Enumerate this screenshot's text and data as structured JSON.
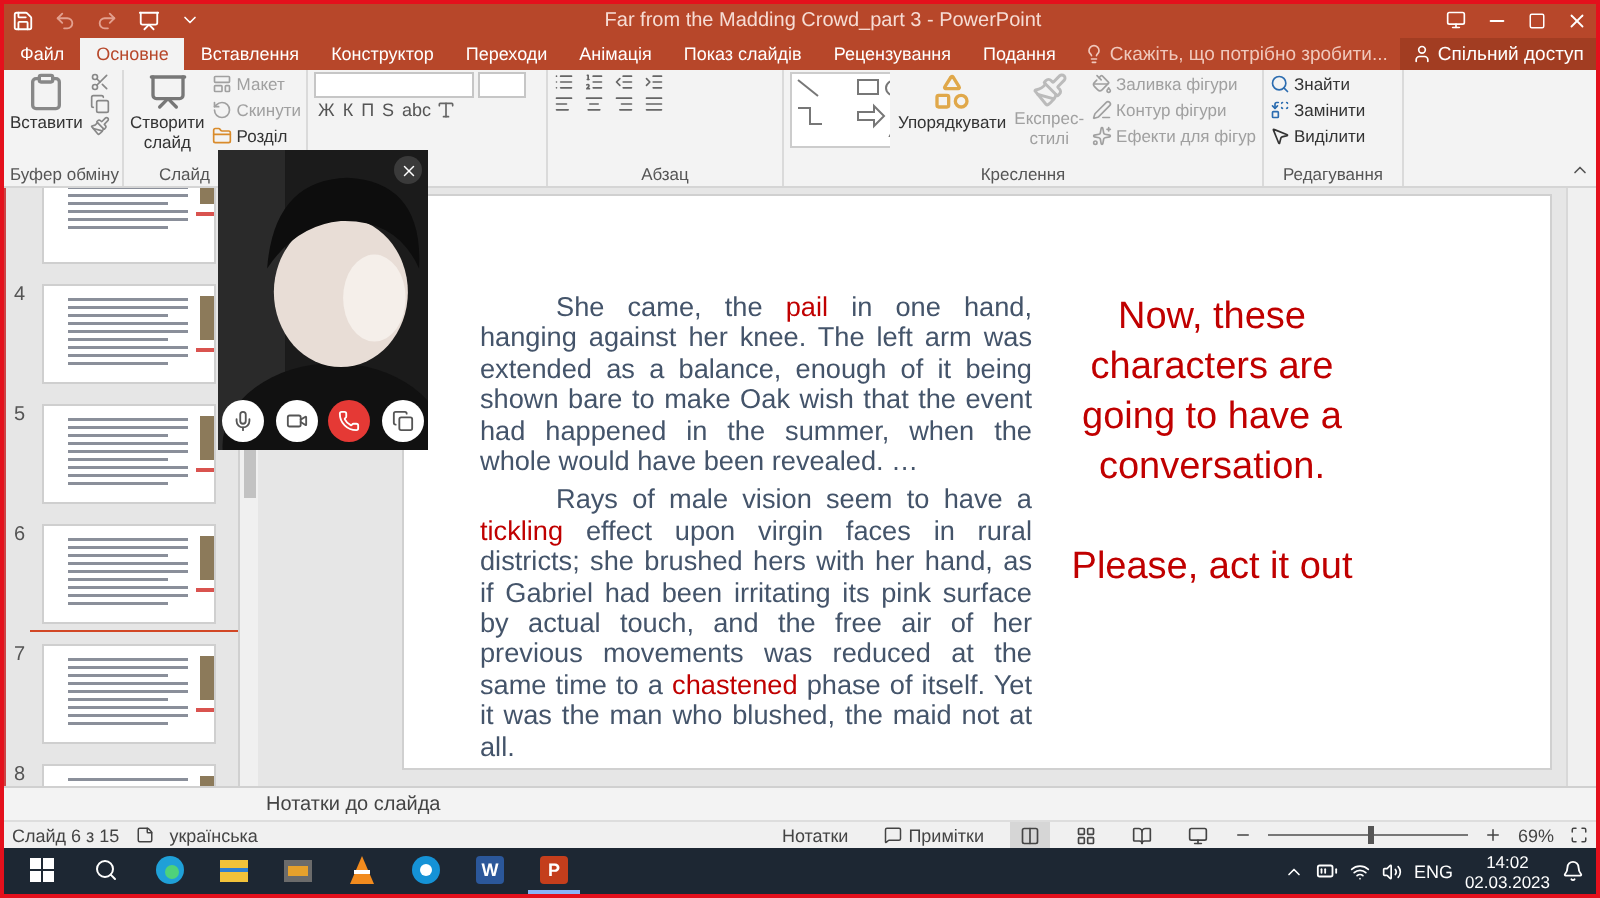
{
  "window": {
    "title": "Far from the Madding Crowd_part 3 - PowerPoint"
  },
  "tabs": [
    {
      "label": "Файл",
      "selected": false
    },
    {
      "label": "Основне",
      "selected": true
    },
    {
      "label": "Вставлення",
      "selected": false
    },
    {
      "label": "Конструктор",
      "selected": false
    },
    {
      "label": "Переходи",
      "selected": false
    },
    {
      "label": "Анімація",
      "selected": false
    },
    {
      "label": "Показ слайдів",
      "selected": false
    },
    {
      "label": "Рецензування",
      "selected": false
    },
    {
      "label": "Подання",
      "selected": false
    }
  ],
  "tell_me": {
    "placeholder": "Скажіть, що потрібно зробити..."
  },
  "share_button": "Спільний доступ",
  "ribbon": {
    "clipboard": {
      "label": "Буфер обміну",
      "paste": "Вставити"
    },
    "slides": {
      "label": "Слайд",
      "new_slide": [
        "Створити",
        "слайд"
      ],
      "items": [
        {
          "label": "Макет",
          "disabled": true
        },
        {
          "label": "Скинути",
          "disabled": true
        },
        {
          "label": "Розділ",
          "disabled": false
        }
      ]
    },
    "font": {
      "format_buttons": [
        "Ж",
        "К",
        "П",
        "S",
        "abc"
      ]
    },
    "paragraph": {
      "label": "Абзац"
    },
    "drawing": {
      "label": "Креслення",
      "arrange": "Упорядкувати",
      "quick_styles": {
        "label": "Експрес-стилі",
        "disabled": true
      },
      "items": [
        {
          "label": "Заливка фігури",
          "disabled": true
        },
        {
          "label": "Контур фігури",
          "disabled": true
        },
        {
          "label": "Ефекти для фігур",
          "disabled": true
        }
      ]
    },
    "editing": {
      "label": "Редагування",
      "items": [
        {
          "label": "Знайти",
          "kind": "find"
        },
        {
          "label": "Замінити",
          "kind": "replace"
        },
        {
          "label": "Виділити",
          "kind": "select"
        }
      ]
    }
  },
  "thumbnails": [
    {
      "number": "4",
      "drop_marker": false
    },
    {
      "number": "5",
      "drop_marker": false
    },
    {
      "number": "6",
      "drop_marker": false
    },
    {
      "number": "7",
      "drop_marker": true
    },
    {
      "number": "8",
      "drop_marker": false
    }
  ],
  "video_call": {
    "controls": [
      {
        "kind": "mic"
      },
      {
        "kind": "camera"
      },
      {
        "kind": "hangup"
      },
      {
        "kind": "switch"
      }
    ]
  },
  "slide": {
    "paragraphs": [
      [
        {
          "text": "She came, the ",
          "highlight": false
        },
        {
          "text": "pail",
          "highlight": true
        },
        {
          "text": " in one hand, hanging against her knee. The left arm was extended as a balance, enough of it being shown bare to make Oak wish that the event had happened in the summer, when the whole would have been revealed. …",
          "highlight": false
        }
      ],
      [
        {
          "text": "Rays of male vision seem to have a ",
          "highlight": false
        },
        {
          "text": "tickling",
          "highlight": true
        },
        {
          "text": " effect upon virgin faces in rural districts; she brushed hers with her hand, as if Gabriel had been irritating its pink surface by actual touch, and the free air of her previous movements was reduced at the same time to a ",
          "highlight": false
        },
        {
          "text": "chastened",
          "highlight": true
        },
        {
          "text": " phase of itself. Yet it was the man who blushed, the maid not at all.",
          "highlight": false
        }
      ]
    ],
    "side_text": [
      "Now, these characters are going to have a conversation.",
      "Please, act it out"
    ]
  },
  "notes": "Нотатки до слайда",
  "status_bar": {
    "slide_info": "Слайд 6 з 15",
    "language": "українська",
    "notes": "Нотатки",
    "comments": "Примітки",
    "views": [
      {
        "kind": "normal",
        "selected": true
      },
      {
        "kind": "sorter",
        "selected": false
      },
      {
        "kind": "reading",
        "selected": false
      },
      {
        "kind": "slideshow",
        "selected": false
      }
    ],
    "zoom_slider": {
      "level": 0.5
    },
    "zoom": "69%"
  },
  "taskbar": {
    "apps": [
      {
        "kind": "edge",
        "active": false
      },
      {
        "kind": "explorer",
        "active": false
      },
      {
        "kind": "media",
        "active": false
      },
      {
        "kind": "vlc",
        "active": false
      },
      {
        "kind": "skype",
        "active": false
      },
      {
        "kind": "word",
        "letter": "W",
        "active": false
      },
      {
        "kind": "powerpoint",
        "letter": "P",
        "active": true
      }
    ],
    "language": "ENG",
    "time": "14:02",
    "date": "02.03.2023"
  }
}
